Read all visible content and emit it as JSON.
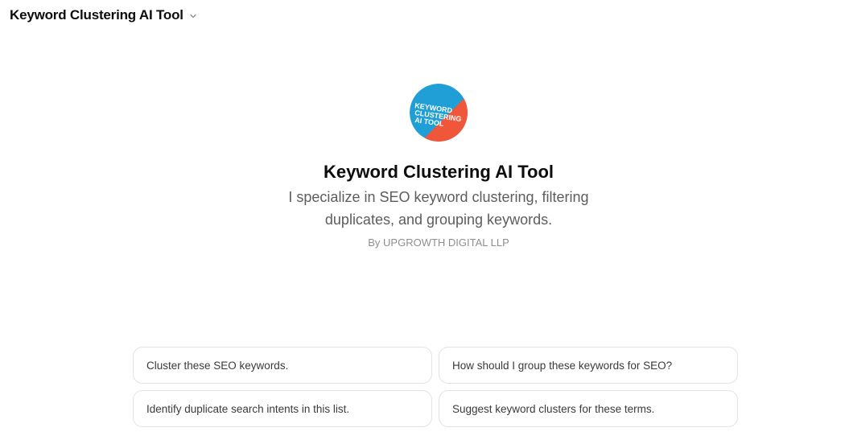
{
  "header": {
    "title": "Keyword Clustering AI Tool"
  },
  "gpt": {
    "logo_text_lines": [
      "KEYWORD",
      "CLUSTERING",
      "AI TOOL"
    ],
    "name": "Keyword Clustering AI Tool",
    "description": "I specialize in SEO keyword clustering, filtering duplicates, and grouping keywords.",
    "author": "By UPGROWTH DIGITAL LLP"
  },
  "suggestions": [
    {
      "label": "Cluster these SEO keywords."
    },
    {
      "label": "How should I group these keywords for SEO?"
    },
    {
      "label": "Identify duplicate search intents in this list."
    },
    {
      "label": "Suggest keyword clusters for these terms."
    }
  ],
  "colors": {
    "logo_blue": "#1f9fd6",
    "logo_orange": "#f0573a",
    "text_primary": "#0d0d0d",
    "text_secondary": "#5d5d5d",
    "text_muted": "#8f8f8f",
    "border": "#e3e3e3"
  },
  "icons": {
    "model_selector": "chevron-down-icon"
  }
}
